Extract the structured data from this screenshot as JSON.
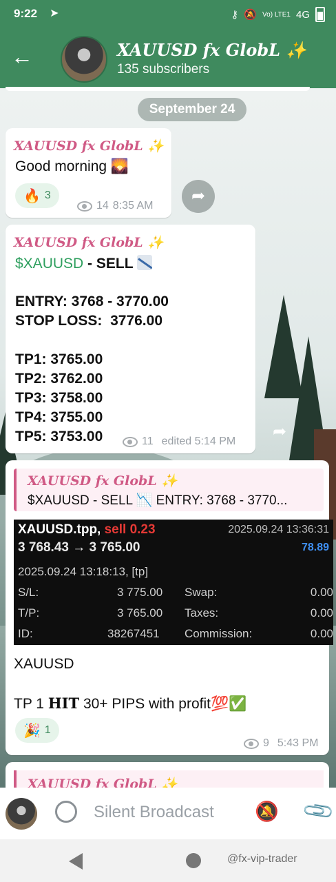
{
  "status_bar": {
    "time": "9:22",
    "telegram_icon": "paper-plane-icon",
    "network": "Vo) LTE1",
    "signal": "4G"
  },
  "header": {
    "back_icon": "arrow-left-icon",
    "title": "XAUUSD fx GlobL ✨",
    "subtitle": "135 subscribers"
  },
  "date_separator": "September 24",
  "messages": [
    {
      "sender": "XAUUSD fx GlobL ✨",
      "text": "Good morning 🌄",
      "reaction": {
        "emoji": "🔥",
        "count": "3"
      },
      "views": "14",
      "time": "8:35 AM"
    },
    {
      "sender": "XAUUSD fx GlobL ✨",
      "symbol": "$XAUUSD",
      "action": " - SELL ",
      "lines": [
        "ENTRY: 3768 - 3770.00",
        "STOP LOSS:  3776.00",
        "TP1: 3765.00",
        "TP2: 3762.00",
        "TP3: 3758.00",
        "TP4: 3755.00",
        "TP5: 3753.00"
      ],
      "views": "11",
      "time": "edited 5:14 PM"
    },
    {
      "reply_sender": "XAUUSD fx GlobL ✨",
      "reply_text": "$XAUUSD - SELL 📉  ENTRY: 3768 - 3770...",
      "screenshot": {
        "symbol": "XAUUSD.tpp,",
        "side": "sell 0.23",
        "datetime_right": "2025.09.24 13:36:31",
        "prices": "3 768.43 → 3 765.00",
        "profit": "78.89",
        "open_time": "2025.09.24 13:18:13, [tp]",
        "sl_label": "S/L:",
        "sl_value": "3 775.00",
        "swap_label": "Swap:",
        "swap_value": "0.00",
        "tp_label": "T/P:",
        "tp_value": "3 765.00",
        "taxes_label": "Taxes:",
        "taxes_value": "0.00",
        "id_label": "ID:",
        "id_value": "38267451",
        "commission_label": "Commission:",
        "commission_value": "0.00"
      },
      "text_line1": "XAUUSD",
      "text_line2_pre": "TP 1 ",
      "text_line2_hit": "HIT",
      "text_line2_post": " 30+ PIPS with profit💯✅",
      "reaction": {
        "emoji": "🎉",
        "count": "1"
      },
      "views": "9",
      "time": "5:43 PM"
    },
    {
      "sender": "XAUUSD fx GlobL ✨"
    }
  ],
  "composer": {
    "placeholder": "Silent Broadcast"
  },
  "navbar": {
    "watermark": "@fx-vip-trader"
  }
}
